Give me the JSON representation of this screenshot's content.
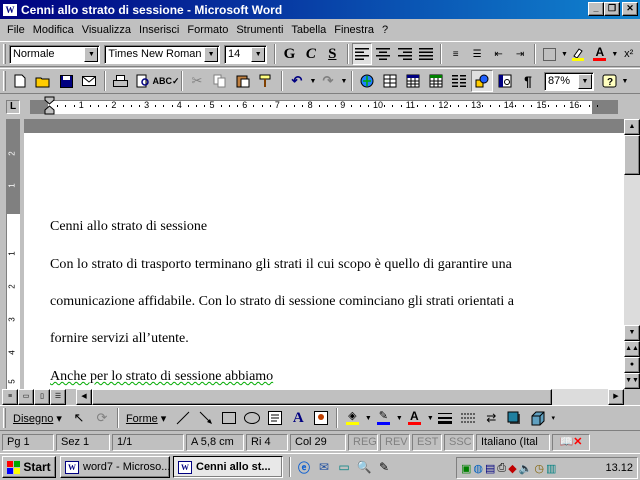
{
  "window": {
    "title": "Cenni allo strato di sessione - Microsoft Word"
  },
  "menu": [
    "File",
    "Modifica",
    "Visualizza",
    "Inserisci",
    "Formato",
    "Strumenti",
    "Tabella",
    "Finestra",
    "?"
  ],
  "format_toolbar": {
    "style": "Normale",
    "font": "Times New Roman",
    "size": "14",
    "bold": "G",
    "italic": "C",
    "underline": "S"
  },
  "standard_toolbar": {
    "zoom": "87%"
  },
  "ruler": {
    "numbers": [
      "1",
      "2",
      "3",
      "4",
      "5",
      "6",
      "7",
      "8",
      "9",
      "10",
      "11",
      "12",
      "13",
      "14",
      "15",
      "16"
    ],
    "vertical_numbers": [
      "2",
      "1",
      "1",
      "2",
      "3",
      "4",
      "5"
    ]
  },
  "document": {
    "heading": "Cenni allo strato di sessione",
    "line1": "Con lo strato di trasporto terminano gli strati il cui scopo è quello di garantire una",
    "line2": "comunicazione affidabile. Con lo strato di sessione cominciano gli strati orientati a",
    "line3": "fornire servizi all’utente.",
    "line4": "Anche per lo strato di sessione abbiamo"
  },
  "drawing_toolbar": {
    "draw": "Disegno",
    "shapes": "Forme"
  },
  "status": {
    "page": "Pg 1",
    "section": "Sez 1",
    "pages": "1/1",
    "at": "A  5,8 cm",
    "line": "Ri  4",
    "col": "Col  29",
    "rec": "REG",
    "trk": "REV",
    "ext": "EST",
    "ovr": "SSC",
    "language": "Italiano (Ital"
  },
  "taskbar": {
    "start": "Start",
    "tasks": [
      "word7 - Microso...",
      "Cenni allo st..."
    ],
    "clock": "13.12"
  },
  "colors": {
    "title_start": "#000080",
    "title_end": "#1084d0",
    "face": "#c0c0c0",
    "shadow": "#808080",
    "highlight": "#ffff00",
    "font_color": "#ff0000"
  }
}
